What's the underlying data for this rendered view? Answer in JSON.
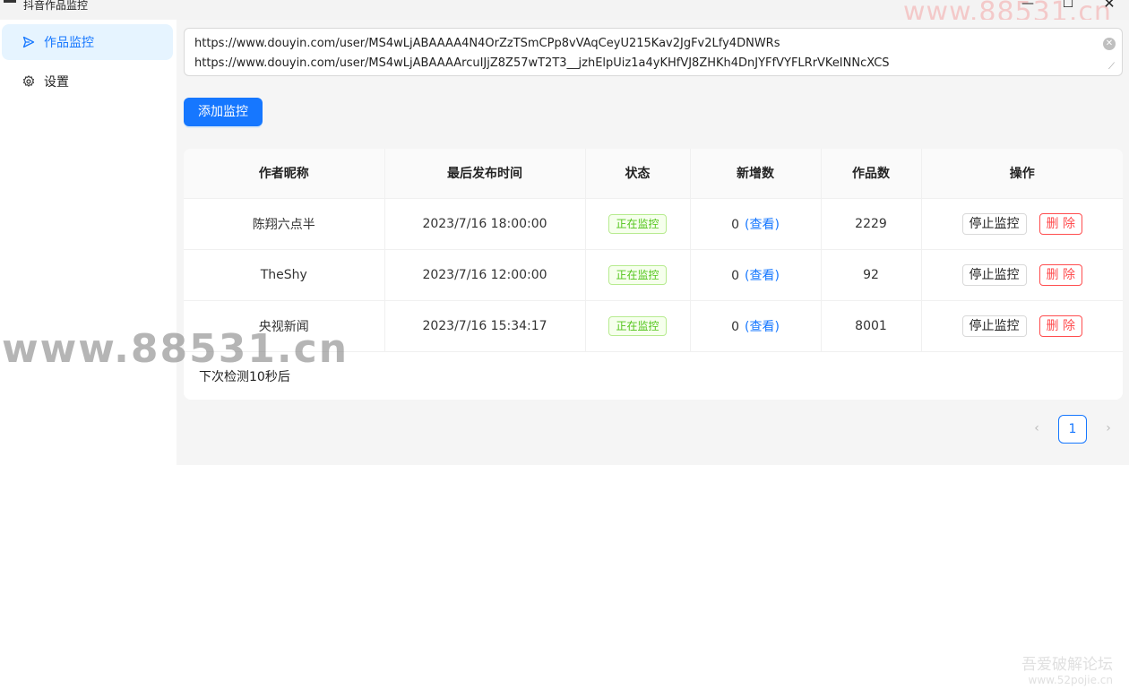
{
  "window": {
    "title": "抖音作品监控",
    "min_glyph": "—",
    "max_glyph": "☐",
    "close_glyph": "✕"
  },
  "watermarks": {
    "top": "www.88531.cn",
    "middle": "www.88531.cn",
    "corner_line1": "吾爱破解论坛",
    "corner_line2": "www.52pojie.cn"
  },
  "sidebar": {
    "items": [
      {
        "label": "作品监控",
        "icon": "send-icon",
        "active": true
      },
      {
        "label": "设置",
        "icon": "gear-icon",
        "active": false
      }
    ]
  },
  "url_input": {
    "value": "https://www.douyin.com/user/MS4wLjABAAAA4N4OrZzTSmCPp8vVAqCeyU215Kav2JgFv2Lfy4DNWRs\nhttps://www.douyin.com/user/MS4wLjABAAAArcuIJjZ8Z57wT2T3__jzhElpUiz1a4yKHfVJ8ZHKh4DnJYFfVYFLRrVKeINNcXCS"
  },
  "add_button": {
    "label": "添加监控"
  },
  "table": {
    "columns": [
      "作者昵称",
      "最后发布时间",
      "状态",
      "新增数",
      "作品数",
      "操作"
    ],
    "rows": [
      {
        "nickname": "陈翔六点半",
        "last_time": "2023/7/16 18:00:00",
        "status": "正在监控",
        "new_count": "0",
        "view_label": "(查看)",
        "works": "2229",
        "stop_label": "停止监控",
        "delete_label": "删 除"
      },
      {
        "nickname": "TheShy",
        "last_time": "2023/7/16 12:00:00",
        "status": "正在监控",
        "new_count": "0",
        "view_label": "(查看)",
        "works": "92",
        "stop_label": "停止监控",
        "delete_label": "删 除"
      },
      {
        "nickname": "央视新闻",
        "last_time": "2023/7/16 15:34:17",
        "status": "正在监控",
        "new_count": "0",
        "view_label": "(查看)",
        "works": "8001",
        "stop_label": "停止监控",
        "delete_label": "删 除"
      }
    ],
    "footer": "下次检测10秒后"
  },
  "pagination": {
    "prev_glyph": "‹",
    "current_page": "1",
    "next_glyph": "›"
  },
  "colors": {
    "accent": "#1677ff",
    "success": "#52c41a",
    "danger": "#ff4d4f",
    "active_bg": "#e6f4ff"
  }
}
